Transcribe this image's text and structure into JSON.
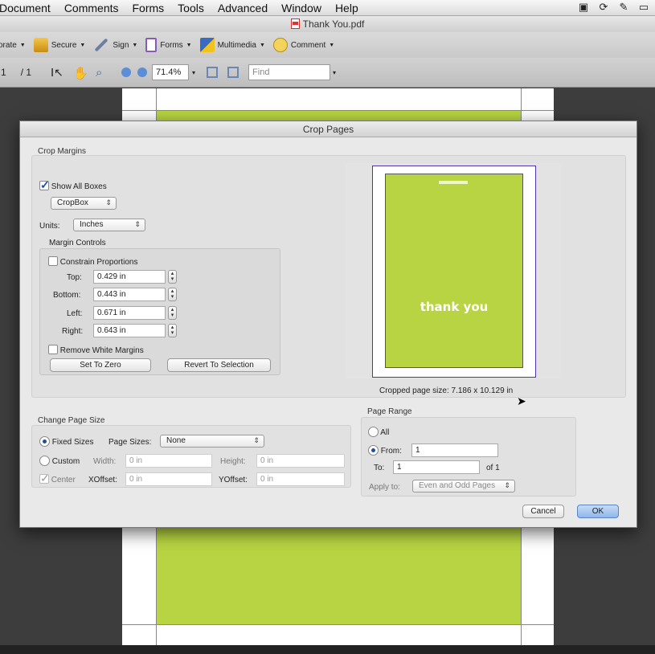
{
  "menubar": {
    "items": [
      "Document",
      "Comments",
      "Forms",
      "Tools",
      "Advanced",
      "Window",
      "Help"
    ],
    "tray_icons": [
      "screen-record-icon",
      "sync-icon",
      "tool-icon",
      "battery-icon"
    ]
  },
  "window": {
    "title": "Thank You.pdf"
  },
  "toolbar1": {
    "items": [
      {
        "label": "orate",
        "icon": "collaborate-icon"
      },
      {
        "label": "Secure",
        "icon": "lock-icon"
      },
      {
        "label": "Sign",
        "icon": "pen-icon"
      },
      {
        "label": "Forms",
        "icon": "form-icon"
      },
      {
        "label": "Multimedia",
        "icon": "multimedia-icon"
      },
      {
        "label": "Comment",
        "icon": "speech-bubble-icon"
      }
    ]
  },
  "toolbar2": {
    "page_current": "1",
    "page_total": "/ 1",
    "zoom": "71.4%",
    "find_placeholder": "Find"
  },
  "dialog": {
    "title": "Crop Pages",
    "crop_margins": {
      "title": "Crop Margins",
      "show_all_boxes": "Show All Boxes",
      "box_select": "CropBox",
      "units_label": "Units:",
      "units_value": "Inches",
      "margin_controls": "Margin Controls",
      "constrain": "Constrain Proportions",
      "top_label": "Top:",
      "top_value": "0.429 in",
      "bottom_label": "Bottom:",
      "bottom_value": "0.443 in",
      "left_label": "Left:",
      "left_value": "0.671 in",
      "right_label": "Right:",
      "right_value": "0.643 in",
      "remove_white": "Remove White Margins",
      "set_to_zero": "Set To Zero",
      "revert": "Revert To Selection"
    },
    "preview": {
      "text": "thank you",
      "cropped_size": "Cropped page size: 7.186 x 10.129 in"
    },
    "change_page_size": {
      "title": "Change Page Size",
      "fixed_sizes": "Fixed Sizes",
      "page_sizes_label": "Page Sizes:",
      "page_sizes_value": "None",
      "custom": "Custom",
      "width_label": "Width:",
      "width_value": "0 in",
      "height_label": "Height:",
      "height_value": "0 in",
      "center": "Center",
      "xoffset_label": "XOffset:",
      "xoffset_value": "0 in",
      "yoffset_label": "YOffset:",
      "yoffset_value": "0 in"
    },
    "page_range": {
      "title": "Page Range",
      "all": "All",
      "from_label": "From:",
      "from_value": "1",
      "to_label": "To:",
      "to_value": "1",
      "of_label": "of 1",
      "apply_label": "Apply to:",
      "apply_value": "Even and Odd Pages"
    },
    "cancel": "Cancel",
    "ok": "OK"
  },
  "colors": {
    "page_green": "#b8d442",
    "accent_blue": "#1e4fa5",
    "preview_frame": "#5533aa"
  }
}
